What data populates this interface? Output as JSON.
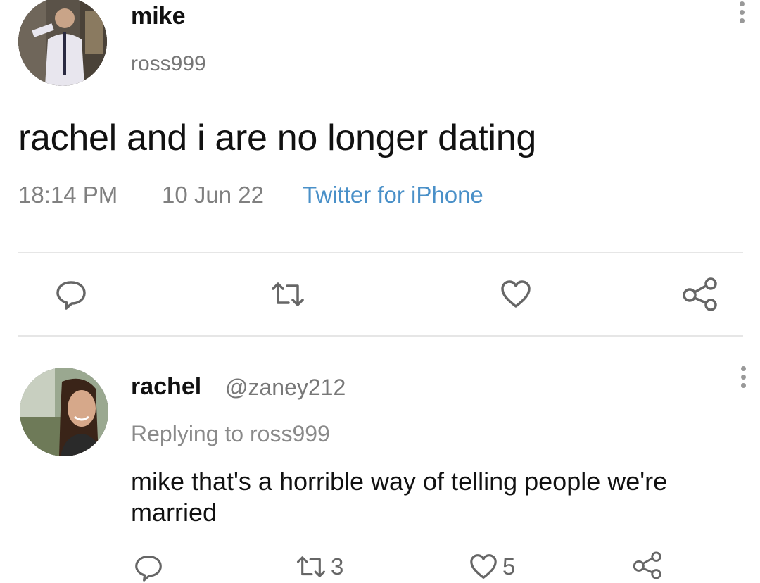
{
  "main_tweet": {
    "display_name": "mike",
    "handle": "ross999",
    "text": "rachel and i are no longer dating",
    "time": "18:14 PM",
    "date": "10 Jun 22",
    "source": "Twitter for iPhone",
    "avatar_icon": "person-photo-avatar",
    "more_icon": "vertical-ellipsis-icon"
  },
  "action_bar": {
    "icons": [
      "comment-icon",
      "retweet-icon",
      "heart-icon",
      "share-icon"
    ]
  },
  "reply": {
    "display_name": "rachel",
    "handle": "@zaney212",
    "replying_to": "Replying to ross999",
    "text": "mike that's a horrible way of telling people we're married",
    "retweet_count": "3",
    "like_count": "5",
    "avatar_icon": "person-photo-avatar",
    "more_icon": "vertical-ellipsis-icon"
  },
  "colors": {
    "background": "#ffffff",
    "text_primary": "#111111",
    "text_secondary": "#808080",
    "source_link": "#4a90c8",
    "divider": "#e6e6e6"
  }
}
